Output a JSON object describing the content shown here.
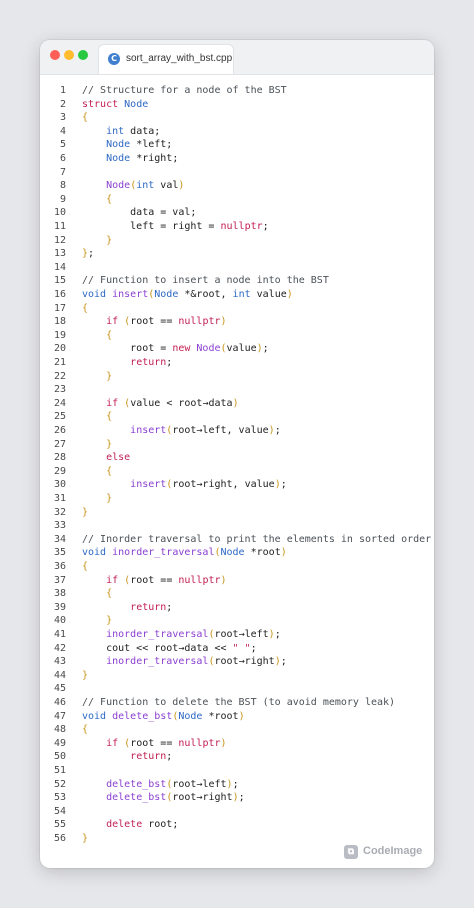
{
  "window": {
    "tab": {
      "icon": "cpp-file-icon",
      "filename": "sort_array_with_bst.cpp"
    }
  },
  "watermark": {
    "icon": "codeimage-logo-icon",
    "label": "CodeImage"
  },
  "colors": {
    "comment": "#4b5157",
    "keyword": "#c21f52",
    "type": "#2d68c4",
    "function": "#8a3fd1",
    "punctuation": "#c7941a",
    "plain": "#222222"
  },
  "code_lines": [
    {
      "n": "1",
      "tokens": [
        [
          "c",
          "// Structure for a node of the BST"
        ]
      ]
    },
    {
      "n": "2",
      "tokens": [
        [
          "k",
          "struct "
        ],
        [
          "t",
          "Node"
        ]
      ]
    },
    {
      "n": "3",
      "tokens": [
        [
          "p",
          "{"
        ]
      ]
    },
    {
      "n": "4",
      "tokens": [
        [
          "x",
          "    "
        ],
        [
          "t",
          "int"
        ],
        [
          "x",
          " data;"
        ]
      ]
    },
    {
      "n": "5",
      "tokens": [
        [
          "x",
          "    "
        ],
        [
          "t",
          "Node"
        ],
        [
          "x",
          " *left;"
        ]
      ]
    },
    {
      "n": "6",
      "tokens": [
        [
          "x",
          "    "
        ],
        [
          "t",
          "Node"
        ],
        [
          "x",
          " *right;"
        ]
      ]
    },
    {
      "n": "7",
      "tokens": []
    },
    {
      "n": "8",
      "tokens": [
        [
          "x",
          "    "
        ],
        [
          "f",
          "Node"
        ],
        [
          "p",
          "("
        ],
        [
          "t",
          "int"
        ],
        [
          "x",
          " val"
        ],
        [
          "p",
          ")"
        ]
      ]
    },
    {
      "n": "9",
      "tokens": [
        [
          "x",
          "    "
        ],
        [
          "p",
          "{"
        ]
      ]
    },
    {
      "n": "10",
      "tokens": [
        [
          "x",
          "        data = val;"
        ]
      ]
    },
    {
      "n": "11",
      "tokens": [
        [
          "x",
          "        left = right = "
        ],
        [
          "k",
          "nullptr"
        ],
        [
          "x",
          ";"
        ]
      ]
    },
    {
      "n": "12",
      "tokens": [
        [
          "x",
          "    "
        ],
        [
          "p",
          "}"
        ]
      ]
    },
    {
      "n": "13",
      "tokens": [
        [
          "p",
          "}"
        ],
        [
          "x",
          ";"
        ]
      ]
    },
    {
      "n": "14",
      "tokens": []
    },
    {
      "n": "15",
      "tokens": [
        [
          "c",
          "// Function to insert a node into the BST"
        ]
      ]
    },
    {
      "n": "16",
      "tokens": [
        [
          "t",
          "void "
        ],
        [
          "f",
          "insert"
        ],
        [
          "p",
          "("
        ],
        [
          "t",
          "Node"
        ],
        [
          "x",
          " *&root, "
        ],
        [
          "t",
          "int"
        ],
        [
          "x",
          " value"
        ],
        [
          "p",
          ")"
        ]
      ]
    },
    {
      "n": "17",
      "tokens": [
        [
          "p",
          "{"
        ]
      ]
    },
    {
      "n": "18",
      "tokens": [
        [
          "x",
          "    "
        ],
        [
          "k",
          "if"
        ],
        [
          "x",
          " "
        ],
        [
          "p",
          "("
        ],
        [
          "x",
          "root == "
        ],
        [
          "k",
          "nullptr"
        ],
        [
          "p",
          ")"
        ]
      ]
    },
    {
      "n": "19",
      "tokens": [
        [
          "x",
          "    "
        ],
        [
          "p",
          "{"
        ]
      ]
    },
    {
      "n": "20",
      "tokens": [
        [
          "x",
          "        root = "
        ],
        [
          "k",
          "new "
        ],
        [
          "f",
          "Node"
        ],
        [
          "p",
          "("
        ],
        [
          "x",
          "value"
        ],
        [
          "p",
          ")"
        ],
        [
          "x",
          ";"
        ]
      ]
    },
    {
      "n": "21",
      "tokens": [
        [
          "x",
          "        "
        ],
        [
          "k",
          "return"
        ],
        [
          "x",
          ";"
        ]
      ]
    },
    {
      "n": "22",
      "tokens": [
        [
          "x",
          "    "
        ],
        [
          "p",
          "}"
        ]
      ]
    },
    {
      "n": "23",
      "tokens": []
    },
    {
      "n": "24",
      "tokens": [
        [
          "x",
          "    "
        ],
        [
          "k",
          "if"
        ],
        [
          "x",
          " "
        ],
        [
          "p",
          "("
        ],
        [
          "x",
          "value < root→data"
        ],
        [
          "p",
          ")"
        ]
      ]
    },
    {
      "n": "25",
      "tokens": [
        [
          "x",
          "    "
        ],
        [
          "p",
          "{"
        ]
      ]
    },
    {
      "n": "26",
      "tokens": [
        [
          "x",
          "        "
        ],
        [
          "f",
          "insert"
        ],
        [
          "p",
          "("
        ],
        [
          "x",
          "root→left, value"
        ],
        [
          "p",
          ")"
        ],
        [
          "x",
          ";"
        ]
      ]
    },
    {
      "n": "27",
      "tokens": [
        [
          "x",
          "    "
        ],
        [
          "p",
          "}"
        ]
      ]
    },
    {
      "n": "28",
      "tokens": [
        [
          "x",
          "    "
        ],
        [
          "k",
          "else"
        ]
      ]
    },
    {
      "n": "29",
      "tokens": [
        [
          "x",
          "    "
        ],
        [
          "p",
          "{"
        ]
      ]
    },
    {
      "n": "30",
      "tokens": [
        [
          "x",
          "        "
        ],
        [
          "f",
          "insert"
        ],
        [
          "p",
          "("
        ],
        [
          "x",
          "root→right, value"
        ],
        [
          "p",
          ")"
        ],
        [
          "x",
          ";"
        ]
      ]
    },
    {
      "n": "31",
      "tokens": [
        [
          "x",
          "    "
        ],
        [
          "p",
          "}"
        ]
      ]
    },
    {
      "n": "32",
      "tokens": [
        [
          "p",
          "}"
        ]
      ]
    },
    {
      "n": "33",
      "tokens": []
    },
    {
      "n": "34",
      "tokens": [
        [
          "c",
          "// Inorder traversal to print the elements in sorted order"
        ]
      ]
    },
    {
      "n": "35",
      "tokens": [
        [
          "t",
          "void "
        ],
        [
          "f",
          "inorder_traversal"
        ],
        [
          "p",
          "("
        ],
        [
          "t",
          "Node"
        ],
        [
          "x",
          " *root"
        ],
        [
          "p",
          ")"
        ]
      ]
    },
    {
      "n": "36",
      "tokens": [
        [
          "p",
          "{"
        ]
      ]
    },
    {
      "n": "37",
      "tokens": [
        [
          "x",
          "    "
        ],
        [
          "k",
          "if"
        ],
        [
          "x",
          " "
        ],
        [
          "p",
          "("
        ],
        [
          "x",
          "root == "
        ],
        [
          "k",
          "nullptr"
        ],
        [
          "p",
          ")"
        ]
      ]
    },
    {
      "n": "38",
      "tokens": [
        [
          "x",
          "    "
        ],
        [
          "p",
          "{"
        ]
      ]
    },
    {
      "n": "39",
      "tokens": [
        [
          "x",
          "        "
        ],
        [
          "k",
          "return"
        ],
        [
          "x",
          ";"
        ]
      ]
    },
    {
      "n": "40",
      "tokens": [
        [
          "x",
          "    "
        ],
        [
          "p",
          "}"
        ]
      ]
    },
    {
      "n": "41",
      "tokens": [
        [
          "x",
          "    "
        ],
        [
          "f",
          "inorder_traversal"
        ],
        [
          "p",
          "("
        ],
        [
          "x",
          "root→left"
        ],
        [
          "p",
          ")"
        ],
        [
          "x",
          ";"
        ]
      ]
    },
    {
      "n": "42",
      "tokens": [
        [
          "x",
          "    cout << root→data << "
        ],
        [
          "k",
          "\" \""
        ],
        [
          "x",
          ";"
        ]
      ]
    },
    {
      "n": "43",
      "tokens": [
        [
          "x",
          "    "
        ],
        [
          "f",
          "inorder_traversal"
        ],
        [
          "p",
          "("
        ],
        [
          "x",
          "root→right"
        ],
        [
          "p",
          ")"
        ],
        [
          "x",
          ";"
        ]
      ]
    },
    {
      "n": "44",
      "tokens": [
        [
          "p",
          "}"
        ]
      ]
    },
    {
      "n": "45",
      "tokens": []
    },
    {
      "n": "46",
      "tokens": [
        [
          "c",
          "// Function to delete the BST (to avoid memory leak)"
        ]
      ]
    },
    {
      "n": "47",
      "tokens": [
        [
          "t",
          "void "
        ],
        [
          "f",
          "delete_bst"
        ],
        [
          "p",
          "("
        ],
        [
          "t",
          "Node"
        ],
        [
          "x",
          " *root"
        ],
        [
          "p",
          ")"
        ]
      ]
    },
    {
      "n": "48",
      "tokens": [
        [
          "p",
          "{"
        ]
      ]
    },
    {
      "n": "49",
      "tokens": [
        [
          "x",
          "    "
        ],
        [
          "k",
          "if"
        ],
        [
          "x",
          " "
        ],
        [
          "p",
          "("
        ],
        [
          "x",
          "root == "
        ],
        [
          "k",
          "nullptr"
        ],
        [
          "p",
          ")"
        ]
      ]
    },
    {
      "n": "50",
      "tokens": [
        [
          "x",
          "        "
        ],
        [
          "k",
          "return"
        ],
        [
          "x",
          ";"
        ]
      ]
    },
    {
      "n": "51",
      "tokens": []
    },
    {
      "n": "52",
      "tokens": [
        [
          "x",
          "    "
        ],
        [
          "f",
          "delete_bst"
        ],
        [
          "p",
          "("
        ],
        [
          "x",
          "root→left"
        ],
        [
          "p",
          ")"
        ],
        [
          "x",
          ";"
        ]
      ]
    },
    {
      "n": "53",
      "tokens": [
        [
          "x",
          "    "
        ],
        [
          "f",
          "delete_bst"
        ],
        [
          "p",
          "("
        ],
        [
          "x",
          "root→right"
        ],
        [
          "p",
          ")"
        ],
        [
          "x",
          ";"
        ]
      ]
    },
    {
      "n": "54",
      "tokens": []
    },
    {
      "n": "55",
      "tokens": [
        [
          "x",
          "    "
        ],
        [
          "k",
          "delete"
        ],
        [
          "x",
          " root;"
        ]
      ]
    },
    {
      "n": "56",
      "tokens": [
        [
          "p",
          "}"
        ]
      ]
    }
  ]
}
